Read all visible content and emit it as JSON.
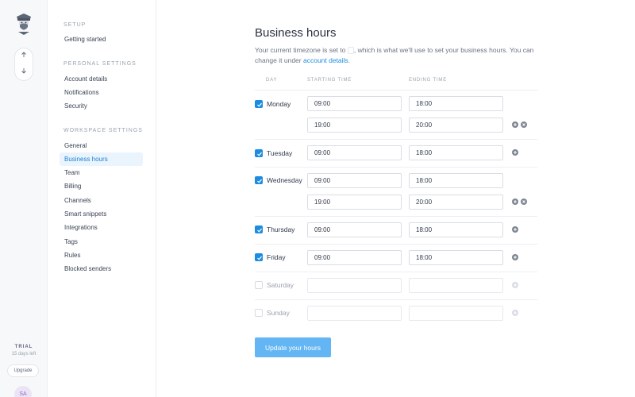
{
  "rail": {
    "up_icon": "arrow-up",
    "down_icon": "arrow-down",
    "trial_label": "TRIAL",
    "trial_days": "15 days left",
    "upgrade_label": "Upgrade",
    "avatar_initials": "SA"
  },
  "nav": {
    "setup_heading": "SETUP",
    "getting_started": "Getting started",
    "personal_heading": "PERSONAL SETTINGS",
    "account_details": "Account details",
    "notifications": "Notifications",
    "security": "Security",
    "workspace_heading": "WORKSPACE SETTINGS",
    "general": "General",
    "business_hours": "Business hours",
    "team": "Team",
    "billing": "Billing",
    "channels": "Channels",
    "smart_snippets": "Smart snippets",
    "integrations": "Integrations",
    "tags": "Tags",
    "rules": "Rules",
    "blocked_senders": "Blocked senders"
  },
  "main": {
    "title": "Business hours",
    "desc_part1": "Your current timezone is set to",
    "desc_part2": ", which is what we'll use to set your business hours. You can change it under",
    "desc_link": "account details",
    "desc_end": ".",
    "col_day": "DAY",
    "col_start": "STARTING TIME",
    "col_end": "ENDING TIME",
    "submit_label": "Update your hours"
  },
  "days": {
    "monday": {
      "label": "Monday",
      "checked": true,
      "slot1_start": "09:00",
      "slot1_end": "18:00",
      "slot2_start": "19:00",
      "slot2_end": "20:00"
    },
    "tuesday": {
      "label": "Tuesday",
      "checked": true,
      "slot1_start": "09:00",
      "slot1_end": "18:00"
    },
    "wednesday": {
      "label": "Wednesday",
      "checked": true,
      "slot1_start": "09:00",
      "slot1_end": "18:00",
      "slot2_start": "19:00",
      "slot2_end": "20:00"
    },
    "thursday": {
      "label": "Thursday",
      "checked": true,
      "slot1_start": "09:00",
      "slot1_end": "18:00"
    },
    "friday": {
      "label": "Friday",
      "checked": true,
      "slot1_start": "09:00",
      "slot1_end": "18:00"
    },
    "saturday": {
      "label": "Saturday",
      "checked": false,
      "slot1_start": "",
      "slot1_end": ""
    },
    "sunday": {
      "label": "Sunday",
      "checked": false,
      "slot1_start": "",
      "slot1_end": ""
    }
  },
  "colors": {
    "accent": "#1d8ce0",
    "button": "#63b6f3",
    "active_nav_bg": "#eaf4fd"
  }
}
